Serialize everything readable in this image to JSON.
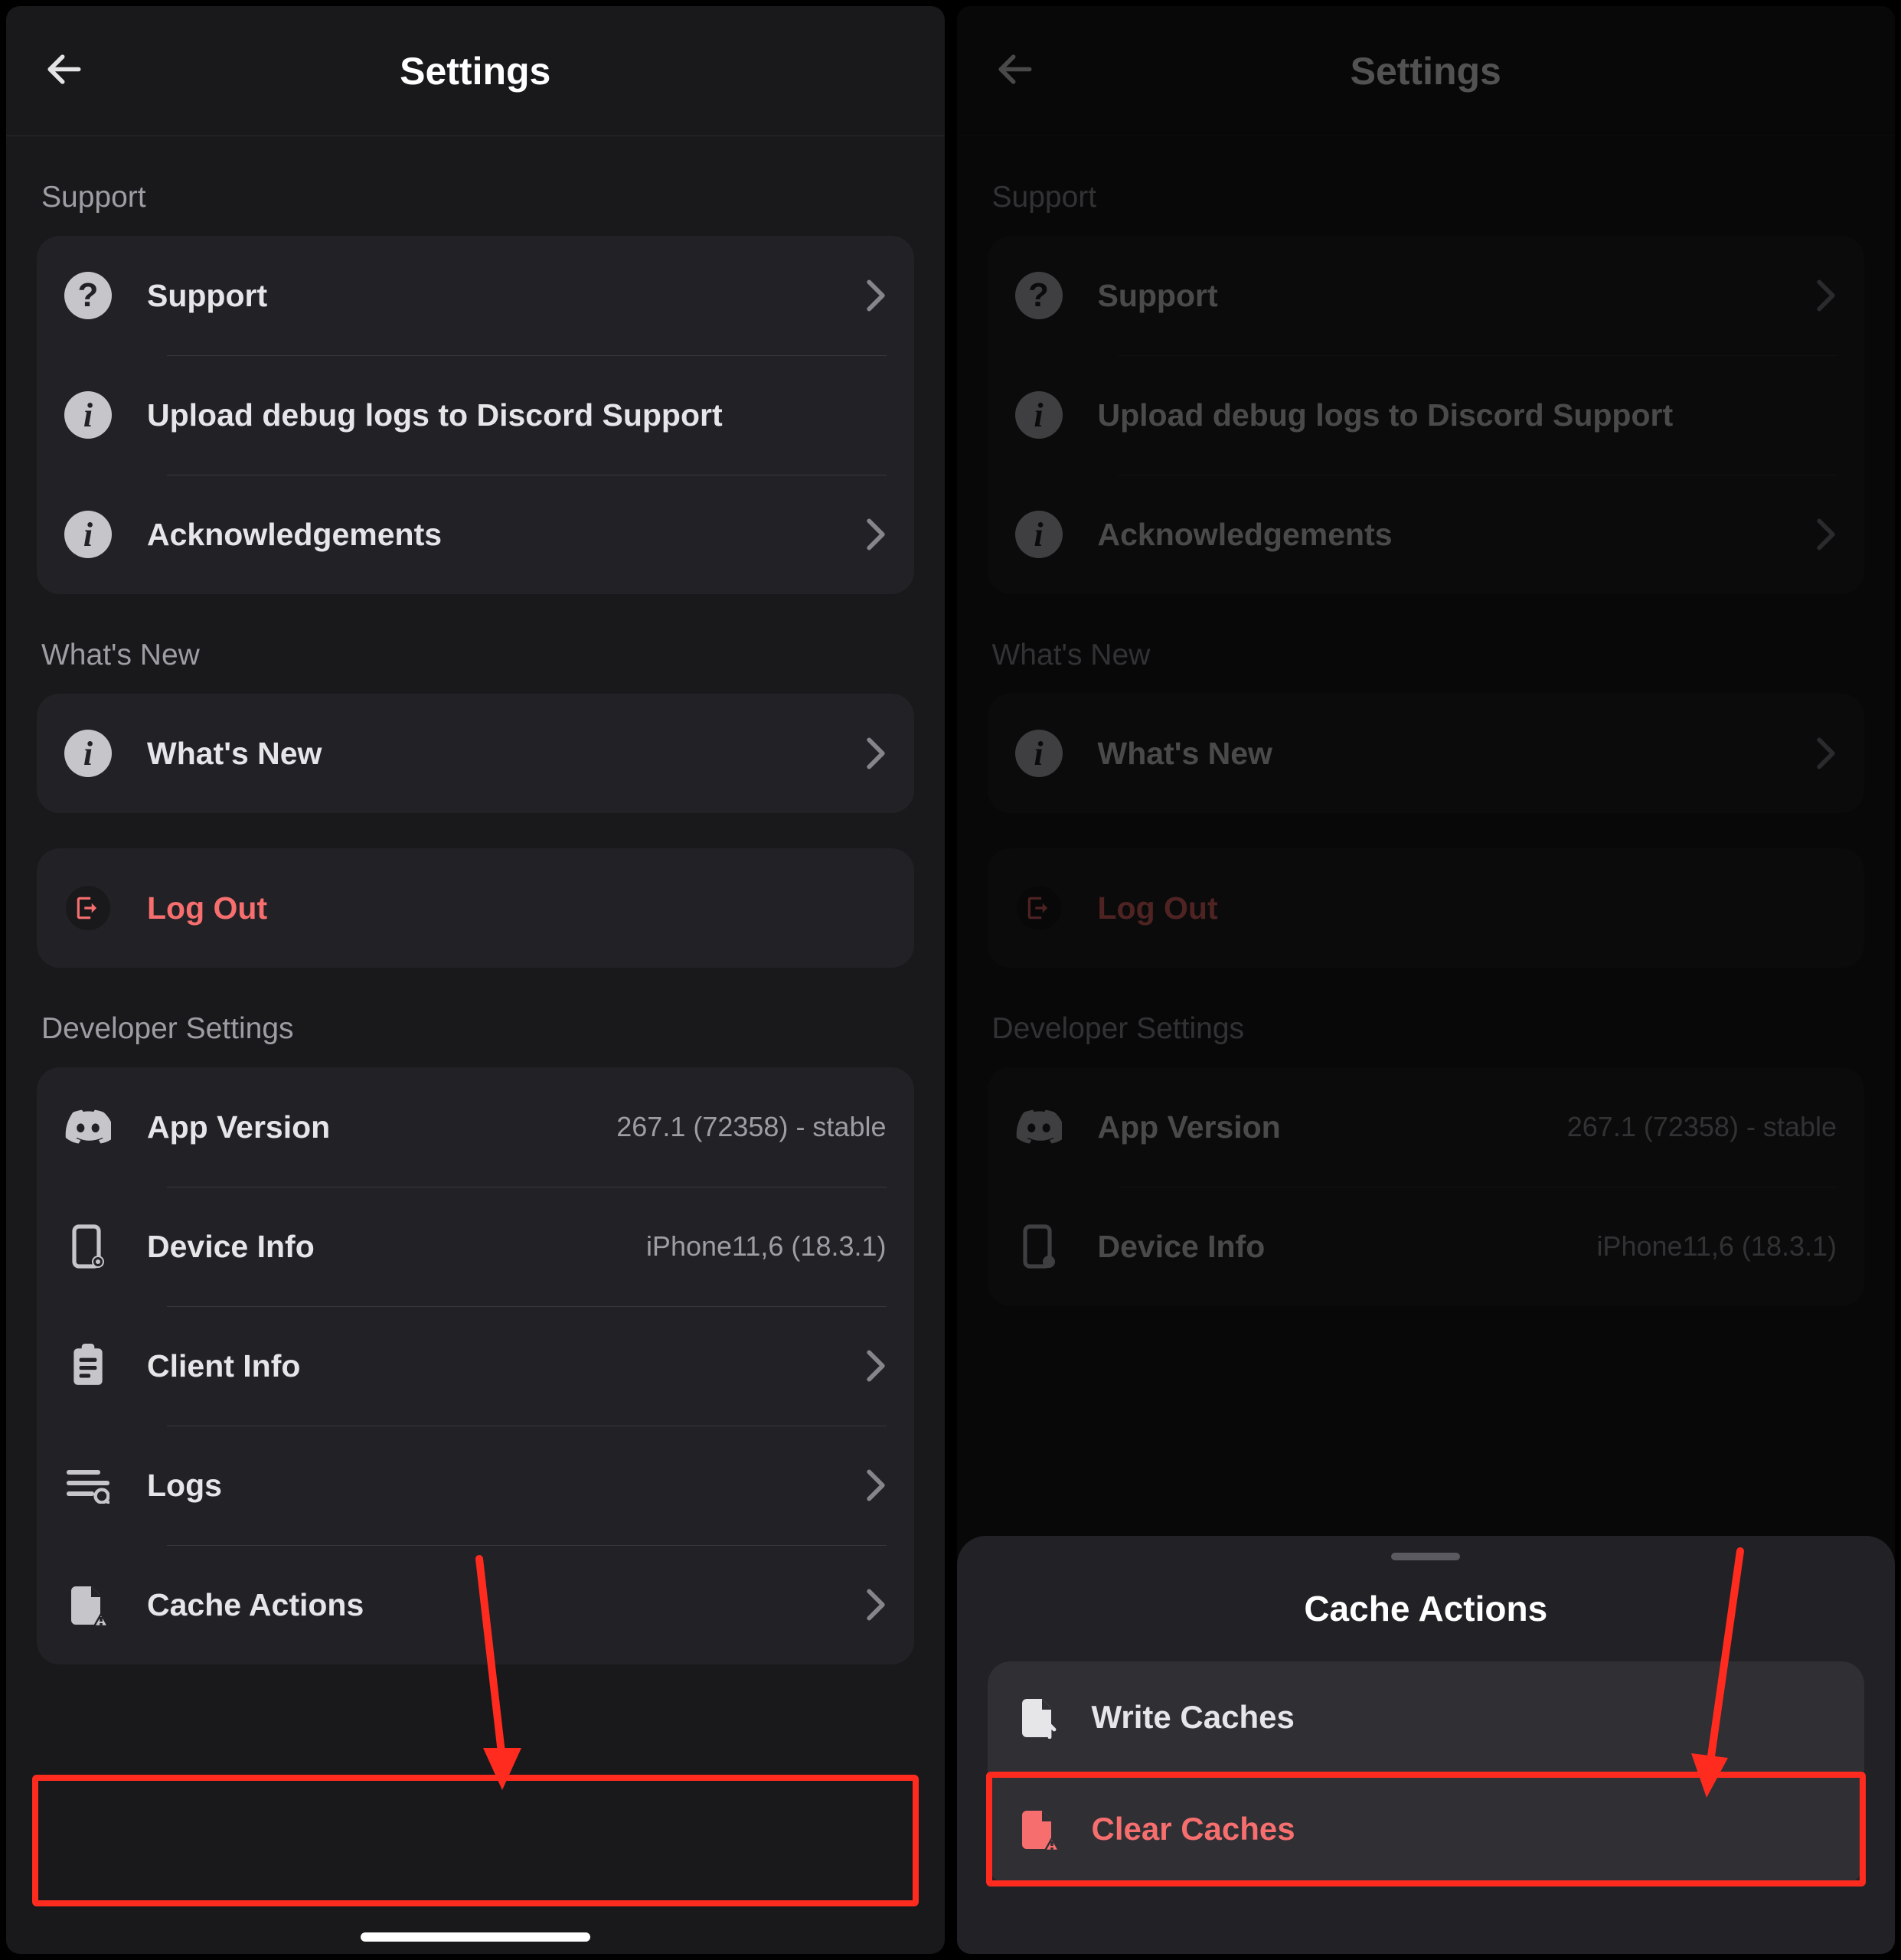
{
  "screens": {
    "left": {
      "header_title": "Settings",
      "sections": [
        {
          "label": "Support",
          "rows": [
            {
              "icon": "help",
              "label": "Support",
              "chevron": true
            },
            {
              "icon": "info",
              "label": "Upload debug logs to Discord Support"
            },
            {
              "icon": "info",
              "label": "Acknowledgements",
              "chevron": true
            }
          ]
        },
        {
          "label": "What's New",
          "rows": [
            {
              "icon": "info",
              "label": "What's New",
              "chevron": true
            }
          ]
        },
        {
          "label": null,
          "rows": [
            {
              "icon": "logout",
              "label": "Log Out",
              "danger": true
            }
          ]
        },
        {
          "label": "Developer Settings",
          "rows": [
            {
              "icon": "discord",
              "label": "App Version",
              "trail": "267.1 (72358) - stable"
            },
            {
              "icon": "device",
              "label": "Device Info",
              "trail": "iPhone11,6 (18.3.1)"
            },
            {
              "icon": "clipboard",
              "label": "Client Info",
              "chevron": true
            },
            {
              "icon": "logs",
              "label": "Logs",
              "chevron": true
            },
            {
              "icon": "cache",
              "label": "Cache Actions",
              "chevron": true
            }
          ]
        }
      ]
    },
    "right": {
      "header_title": "Settings",
      "sheet": {
        "title": "Cache Actions",
        "rows": [
          {
            "icon": "cache-up",
            "label": "Write Caches"
          },
          {
            "icon": "cache-warn",
            "label": "Clear Caches",
            "danger": true
          }
        ]
      }
    }
  }
}
